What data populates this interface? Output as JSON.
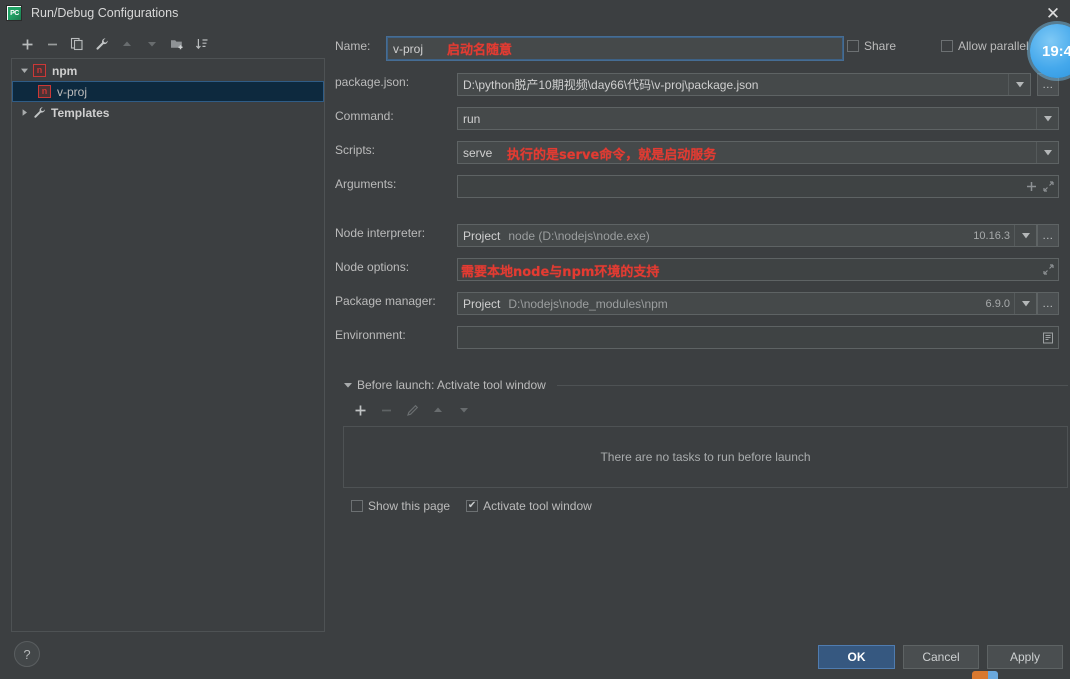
{
  "window": {
    "title": "Run/Debug Configurations",
    "app_icon": "pycharm-icon",
    "app_icon_text": "PC",
    "close_icon": "✕"
  },
  "sidebar": {
    "toolbar": [
      {
        "name": "add-configuration-button",
        "glyph": "+",
        "enabled": true
      },
      {
        "name": "remove-configuration-button",
        "glyph": "−",
        "enabled": true
      },
      {
        "name": "copy-configuration-button",
        "glyph": "❐",
        "enabled": true
      },
      {
        "name": "edit-templates-button",
        "glyph": "⚒",
        "enabled": true
      },
      {
        "name": "move-up-button",
        "glyph": "▲",
        "enabled": false
      },
      {
        "name": "move-down-button",
        "glyph": "▼",
        "enabled": false
      },
      {
        "name": "move-into-folder-button",
        "glyph": "❐",
        "enabled": true
      },
      {
        "name": "sort-configurations-button",
        "glyph": "⇅",
        "enabled": true
      }
    ],
    "tree": [
      {
        "label": "npm",
        "icon": "npm-icon",
        "expander": "▼",
        "level": 0,
        "selected": false,
        "bold": true
      },
      {
        "label": "v-proj",
        "icon": "npm-icon",
        "expander": "",
        "level": 1,
        "selected": true,
        "bold": false
      },
      {
        "label": "Templates",
        "icon": "wrench-icon",
        "expander": "▶",
        "level": 0,
        "selected": false,
        "bold": true
      }
    ]
  },
  "form": {
    "name": {
      "label": "Name:",
      "value": "v-proj",
      "annotation": "启动名随意"
    },
    "share": {
      "label": "Share",
      "checked": false
    },
    "allow_parallel": {
      "label": "Allow parallel run",
      "checked": false
    },
    "package_json": {
      "label": "package.json:",
      "value": "D:\\python脱产10期视频\\day66\\代码\\v-proj\\package.json",
      "browse_label": "..."
    },
    "command": {
      "label": "Command:",
      "value": "run"
    },
    "scripts": {
      "label": "Scripts:",
      "value": "serve",
      "annotation": "执行的是serve命令，就是启动服务"
    },
    "arguments": {
      "label": "Arguments:",
      "value": "",
      "add_icon": "+",
      "expand_icon": "⤡"
    },
    "node_interpreter": {
      "label": "Node interpreter:",
      "scope": "Project",
      "value": "node (D:\\nodejs\\node.exe)",
      "version": "10.16.3",
      "browse_label": "..."
    },
    "node_options": {
      "label": "Node options:",
      "value": "",
      "annotation": "需要本地node与npm环境的支持",
      "expand_icon": "⤡"
    },
    "package_manager": {
      "label": "Package manager:",
      "scope": "Project",
      "value": "D:\\nodejs\\node_modules\\npm",
      "version": "6.9.0",
      "browse_label": "..."
    },
    "environment": {
      "label": "Environment:",
      "value": "",
      "edit_icon": "▤"
    }
  },
  "before_launch": {
    "title": "Before launch: Activate tool window",
    "expander": "▼",
    "toolbar": [
      {
        "name": "add-task-button",
        "glyph": "+",
        "enabled": true
      },
      {
        "name": "remove-task-button",
        "glyph": "−",
        "enabled": false
      },
      {
        "name": "edit-task-button",
        "glyph": "✎",
        "enabled": false
      },
      {
        "name": "task-move-up-button",
        "glyph": "▲",
        "enabled": false
      },
      {
        "name": "task-move-down-button",
        "glyph": "▼",
        "enabled": false
      }
    ],
    "empty_text": "There are no tasks to run before launch",
    "show_this_page": {
      "label": "Show this page",
      "checked": false
    },
    "activate_tool_window": {
      "label": "Activate tool window",
      "checked": true,
      "mark": "✔"
    }
  },
  "footer": {
    "help_label": "?",
    "ok_label": "OK",
    "cancel_label": "Cancel",
    "apply_label": "Apply"
  },
  "overlay": {
    "time_bubble_text": "19:4"
  },
  "colors": {
    "background": "#3c3f41",
    "field_background": "#45494a",
    "selection": "#0d293e",
    "accent_button": "#365880",
    "annotation_red": "#e33b32",
    "npm_red": "#cb3837",
    "bubble_blue": "#44a8ec"
  }
}
